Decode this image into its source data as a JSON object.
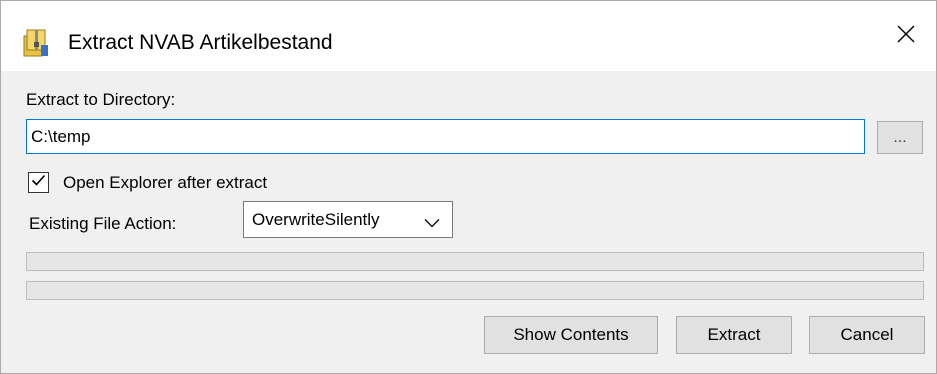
{
  "window": {
    "title": "Extract NVAB Artikelbestand",
    "icon": "archive-zip-icon",
    "close_icon": "close-icon"
  },
  "form": {
    "directory_label": "Extract to Directory:",
    "directory_value": "C:\\temp",
    "browse_label": "...",
    "open_explorer_label": "Open Explorer after extract",
    "open_explorer_checked": true,
    "file_action_label": "Existing File Action:",
    "file_action_value": "OverwriteSilently"
  },
  "progress": {
    "bar1": 0,
    "bar2": 0
  },
  "buttons": {
    "show_contents": "Show Contents",
    "extract": "Extract",
    "cancel": "Cancel"
  },
  "colors": {
    "focus_border": "#0078d7",
    "button_face": "#e1e1e1",
    "dialog_background": "#f0f0f0"
  }
}
